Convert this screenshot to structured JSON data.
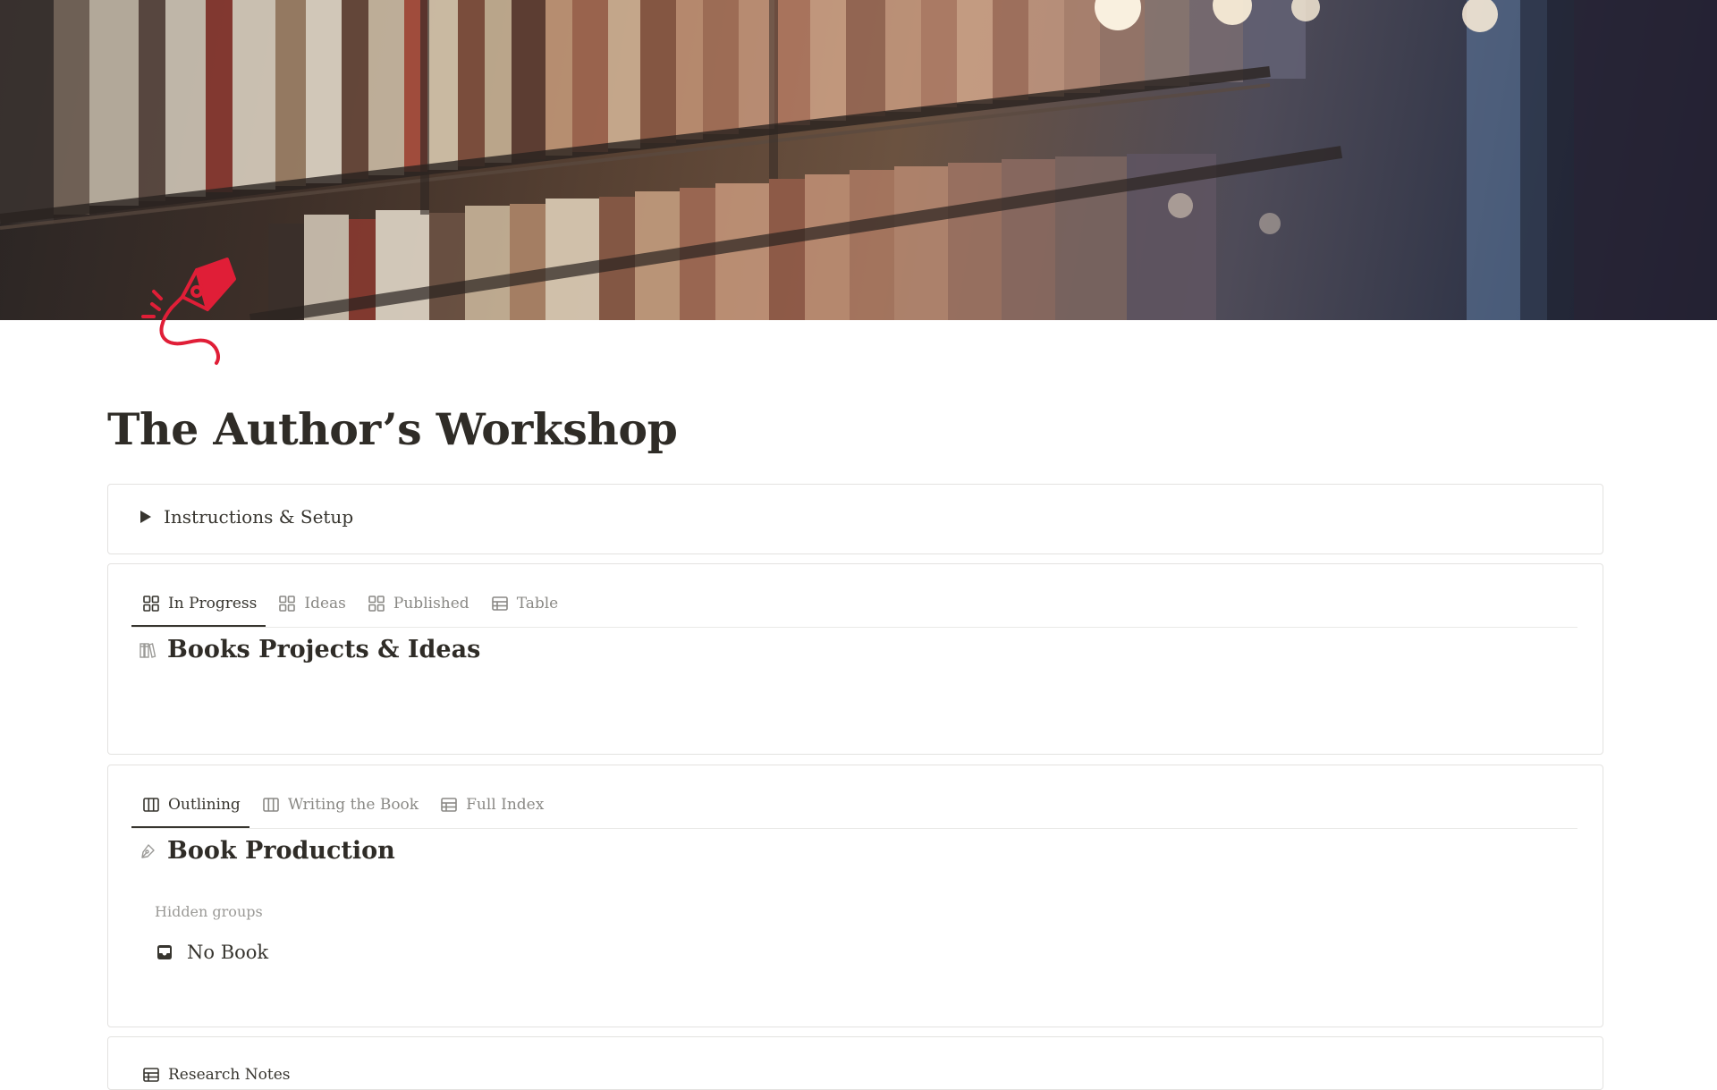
{
  "page": {
    "title": "The Author’s Workshop"
  },
  "cover": {
    "description_icon": "library-bookshelf-cover",
    "accent_color": "#e01e37"
  },
  "page_icon": {
    "icon": "fountain-pen-icon",
    "color": "#e01e37"
  },
  "toggle": {
    "label": "Instructions & Setup",
    "icon": "triangle-right-icon"
  },
  "projects_db": {
    "tabs": [
      {
        "label": "In Progress",
        "icon": "gallery-icon",
        "active": true
      },
      {
        "label": "Ideas",
        "icon": "gallery-icon",
        "active": false
      },
      {
        "label": "Published",
        "icon": "gallery-icon",
        "active": false
      },
      {
        "label": "Table",
        "icon": "table-icon",
        "active": false
      }
    ],
    "title": "Books Projects & Ideas",
    "title_icon": "books-icon"
  },
  "production_db": {
    "tabs": [
      {
        "label": "Outlining",
        "icon": "board-icon",
        "active": true
      },
      {
        "label": "Writing the Book",
        "icon": "board-icon",
        "active": false
      },
      {
        "label": "Full Index",
        "icon": "table-icon",
        "active": false
      }
    ],
    "title": "Book Production",
    "title_icon": "pen-icon",
    "hidden_groups_label": "Hidden groups",
    "hidden_group": {
      "label": "No Book",
      "icon": "inbox-icon"
    }
  },
  "next_db": {
    "partial_tab_label": "Research Notes",
    "partial_tab_icon": "table-icon"
  },
  "colors": {
    "text": "#37352f",
    "muted": "#8a8985",
    "border": "#e3e2e0",
    "accent": "#e01e37"
  }
}
